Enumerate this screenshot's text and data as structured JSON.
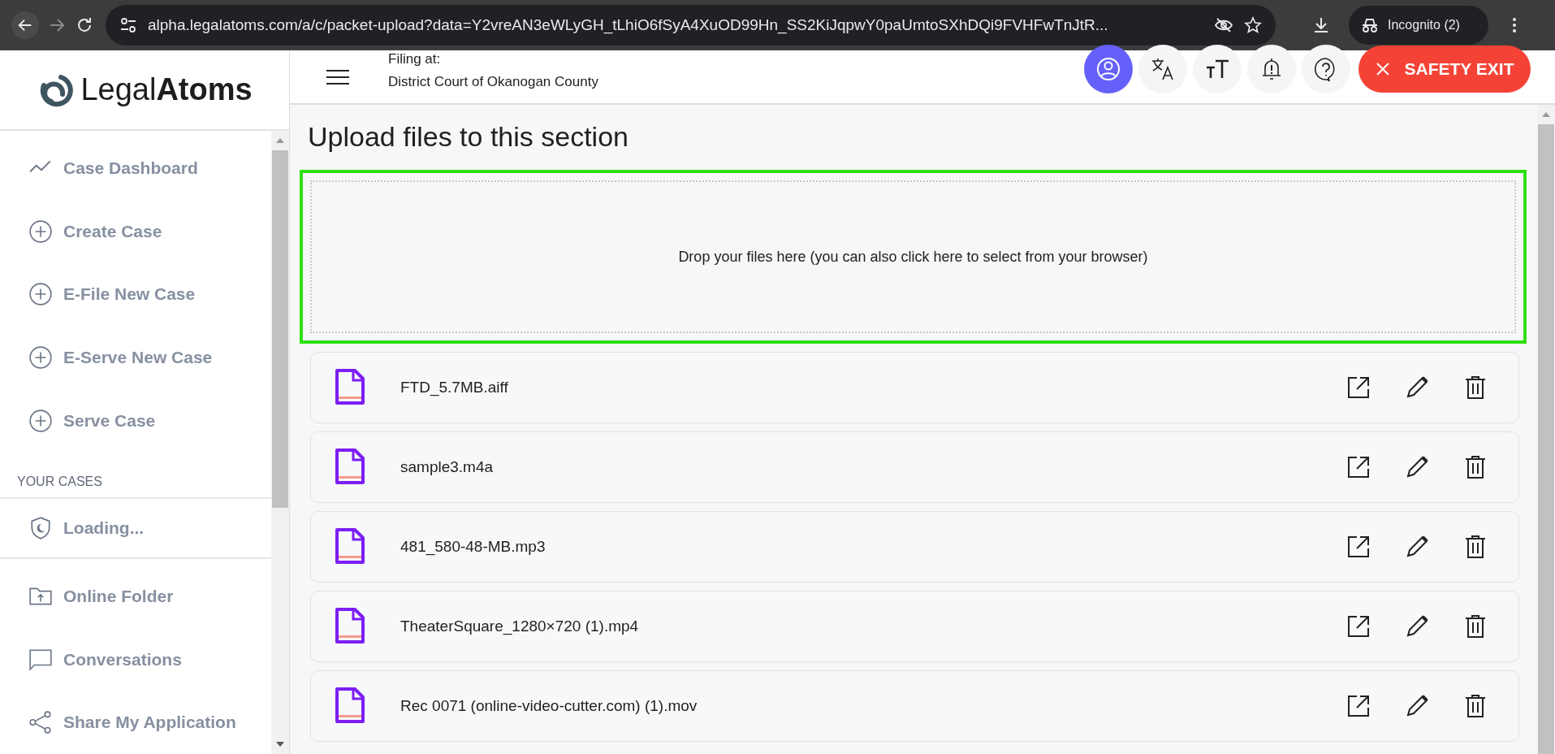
{
  "browser": {
    "url": "alpha.legalatoms.com/a/c/packet-upload?data=Y2vreAN3eWLyGH_tLhiO6fSyA4XuOD99Hn_SS2KiJqpwY0paUmtoSXhDQi9FVHFwTnJtR...",
    "incognito": "Incognito (2)"
  },
  "sidebar": {
    "logo": {
      "light": "Legal",
      "bold": "Atoms"
    },
    "nav_items": [
      {
        "label": "Case Dashboard",
        "kind": "dashboard"
      },
      {
        "label": "Create Case",
        "kind": "add"
      },
      {
        "label": "E-File New Case",
        "kind": "add"
      },
      {
        "label": "E-Serve New Case",
        "kind": "add"
      },
      {
        "label": "Serve Case",
        "kind": "add"
      }
    ],
    "section_label": "YOUR CASES",
    "cases": [
      {
        "label": "Loading...",
        "kind": "shield"
      }
    ],
    "bottom_items": [
      {
        "label": "Online Folder",
        "kind": "folder"
      },
      {
        "label": "Conversations",
        "kind": "chat"
      },
      {
        "label": "Share My Application",
        "kind": "share"
      }
    ]
  },
  "header": {
    "filing_label": "Filing at:",
    "court": "District Court of Okanogan County",
    "buttons": [
      {
        "kind": "profile",
        "selected": true
      },
      {
        "kind": "translate",
        "selected": false
      },
      {
        "kind": "text-size",
        "selected": false
      },
      {
        "kind": "notifications",
        "selected": false
      },
      {
        "kind": "help",
        "selected": false
      }
    ],
    "safety_exit": "SAFETY EXIT"
  },
  "main": {
    "title": "Upload files to this section",
    "dropzone": "Drop your files here (you can also click here to select from your browser)",
    "files": [
      {
        "name": "FTD_5.7MB.aiff"
      },
      {
        "name": "sample3.m4a"
      },
      {
        "name": "481_580-48-MB.mp3"
      },
      {
        "name": "TheaterSquare_1280×720 (1).mp4"
      },
      {
        "name": "Rec 0071 (online-video-cutter.com) (1).mov"
      }
    ]
  }
}
